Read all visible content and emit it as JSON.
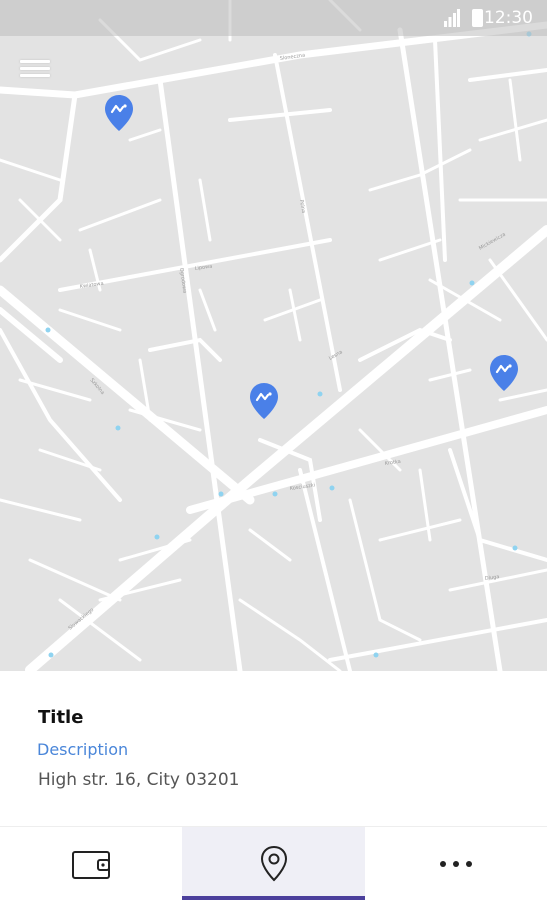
{
  "status_bar": {
    "time": "12:30",
    "icons": [
      "signal-icon",
      "battery-icon"
    ]
  },
  "map": {
    "menu_icon": "hamburger-menu-icon",
    "pin_icon": "location-pin-icon",
    "pin_color": "#4a80e8",
    "street_labels": [
      "Sloneczna",
      "Kwiatowa",
      "Lipowa",
      "Ogrodowa",
      "Polna",
      "Lesna",
      "Szkolna",
      "Mickiewicza",
      "Kosciuszki",
      "Slowackiego",
      "Krotka",
      "Dluga"
    ]
  },
  "info": {
    "title": "Title",
    "description": "Description",
    "address": "High str. 16, City 03201"
  },
  "nav": {
    "tabs": [
      {
        "name": "wallet",
        "icon": "wallet-icon"
      },
      {
        "name": "map",
        "icon": "location-pin-icon",
        "active": true
      },
      {
        "name": "more",
        "icon": "more-dots-icon"
      }
    ],
    "accent_color": "#4b3f9c"
  }
}
